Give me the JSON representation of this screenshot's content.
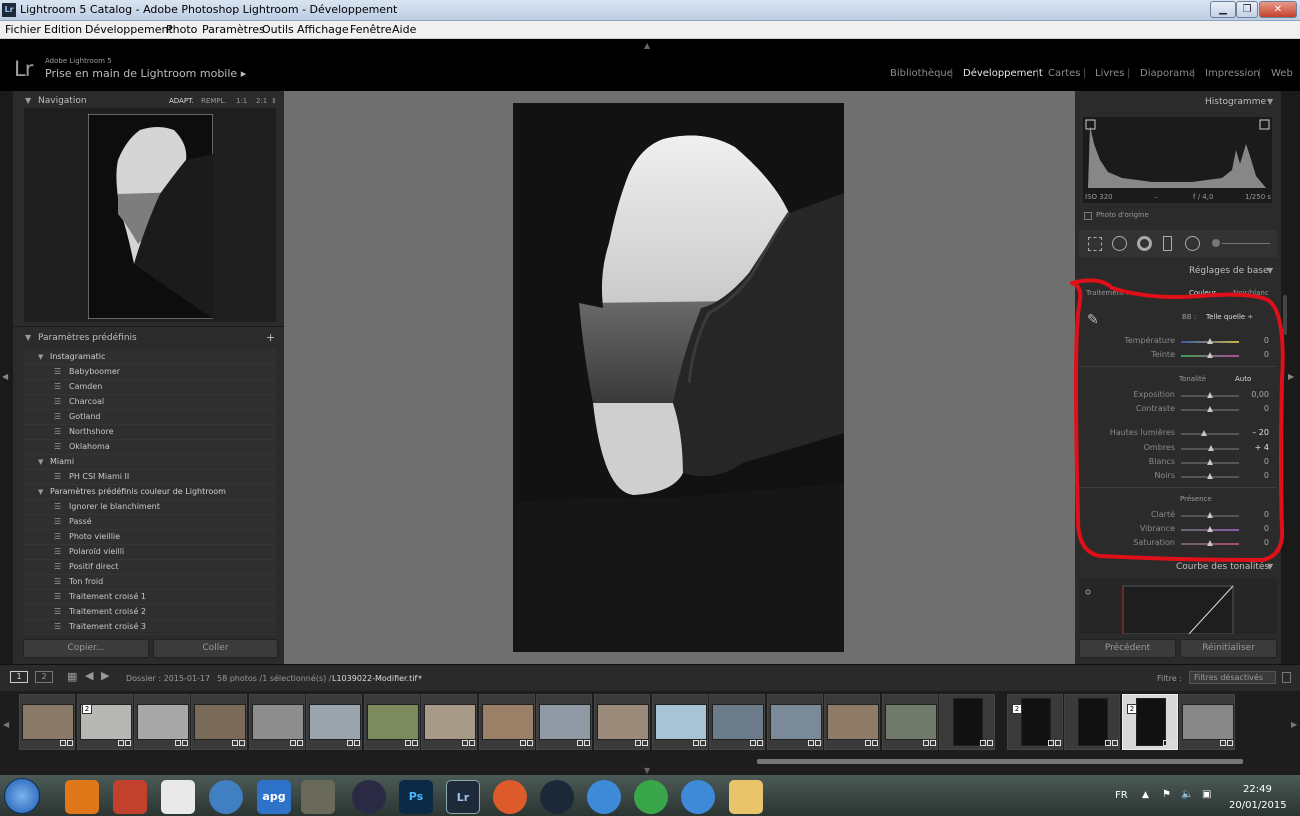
{
  "window": {
    "title": "Lightroom 5 Catalog - Adobe Photoshop Lightroom - Développement",
    "app_icon": "Lr"
  },
  "menu": [
    "Fichier",
    "Edition",
    "Développement",
    "Photo",
    "Paramètres",
    "Outils",
    "Affichage",
    "Fenêtre",
    "Aide"
  ],
  "header": {
    "logo": "Lr",
    "version": "Adobe Lightroom 5",
    "catalog": "Prise en main de Lightroom mobile",
    "catalog_arrow": "▸",
    "modules": [
      "Bibliothèque",
      "Développement",
      "Cartes",
      "Livres",
      "Diaporama",
      "Impression",
      "Web"
    ]
  },
  "navigator": {
    "title": "Navigation",
    "zoom": [
      "ADAPT.",
      "REMPL.",
      "1:1",
      "2:1"
    ]
  },
  "presets": {
    "title": "Paramètres prédéfinis",
    "add": "+",
    "groups": [
      {
        "name": "Instagramatic",
        "items": [
          "Babyboomer",
          "Camden",
          "Charcoal",
          "Gotland",
          "Northshore",
          "Oklahoma"
        ]
      },
      {
        "name": "Miami",
        "items": [
          "PH CSI Miami II"
        ]
      },
      {
        "name": "Paramètres prédéfinis couleur de Lightroom",
        "items": [
          "Ignorer le blanchiment",
          "Passé",
          "Photo vieillie",
          "Polaroïd vieilli",
          "Positif direct",
          "Ton froid",
          "Traitement croisé 1",
          "Traitement croisé 2",
          "Traitement croisé 3"
        ]
      }
    ]
  },
  "left_buttons": {
    "copy": "Copier...",
    "paste": "Coller"
  },
  "histogram": {
    "title": "Histogramme",
    "iso": "ISO 320",
    "lens": "–",
    "aperture": "f / 4,0",
    "shutter": "1/250 s",
    "original": "Photo d'origine"
  },
  "basic": {
    "title": "Réglages de base",
    "treatment_label": "Traitement :",
    "color": "Couleur",
    "bw": "Noir/blanc",
    "wb_label": "BB :",
    "wb_value": "Telle quelle ÷",
    "temp_label": "Température",
    "temp": "0",
    "tint_label": "Teinte",
    "tint": "0",
    "tone_label": "Tonalité",
    "auto": "Auto",
    "tone": [
      {
        "label": "Exposition",
        "value": "0,00",
        "pos": 0.5
      },
      {
        "label": "Contraste",
        "value": "0",
        "pos": 0.5
      },
      {
        "label": "Hautes lumières",
        "value": "– 20",
        "pos": 0.4
      },
      {
        "label": "Ombres",
        "value": "+ 4",
        "pos": 0.52
      },
      {
        "label": "Blancs",
        "value": "0",
        "pos": 0.5
      },
      {
        "label": "Noirs",
        "value": "0",
        "pos": 0.5
      }
    ],
    "presence_label": "Présence",
    "presence": [
      {
        "label": "Clarté",
        "value": "0",
        "pos": 0.5
      },
      {
        "label": "Vibrance",
        "value": "0",
        "pos": 0.5
      },
      {
        "label": "Saturation",
        "value": "0",
        "pos": 0.5
      }
    ]
  },
  "curve": {
    "title": "Courbe des tonalités"
  },
  "right_buttons": {
    "previous": "Précédent",
    "reset": "Réinitialiser"
  },
  "filmbar": {
    "view1": "1",
    "view2": "2",
    "folder": "Dossier : 2015-01-17",
    "count": "58 photos /1 sélectionné(s) /",
    "file": "L1039022-Modifier.tif",
    "filter_label": "Filtre :",
    "filter_value": "Filtres désactivés"
  },
  "filmstrip": {
    "badge": "2"
  },
  "taskbar": {
    "lang": "FR",
    "time": "22:49",
    "date": "20/01/2015",
    "ps": "Ps",
    "lr": "Lr",
    "apg": "apg"
  }
}
